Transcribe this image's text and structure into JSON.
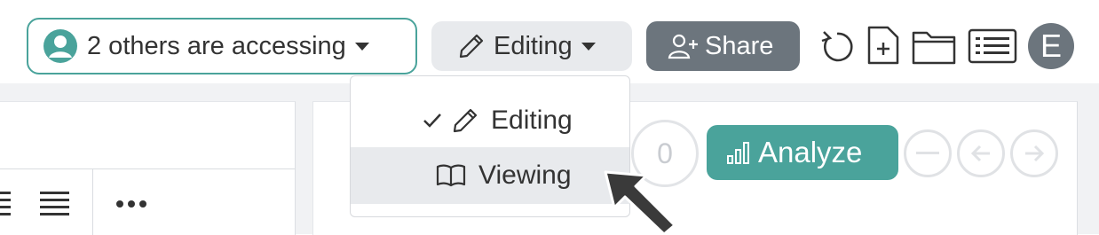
{
  "header": {
    "access_label": "2 others are accessing",
    "mode_label": "Editing",
    "share_label": "Share",
    "user_initial": "E"
  },
  "mode_menu": {
    "items": [
      {
        "label": "Editing",
        "icon": "pencil-icon",
        "selected": true
      },
      {
        "label": "Viewing",
        "icon": "book-icon",
        "selected": false
      }
    ]
  },
  "analysis": {
    "counter": "0",
    "analyze_label": "Analyze"
  },
  "colors": {
    "accent": "#4aa39b",
    "secondary": "#6c757d",
    "light": "#e8eaed"
  }
}
